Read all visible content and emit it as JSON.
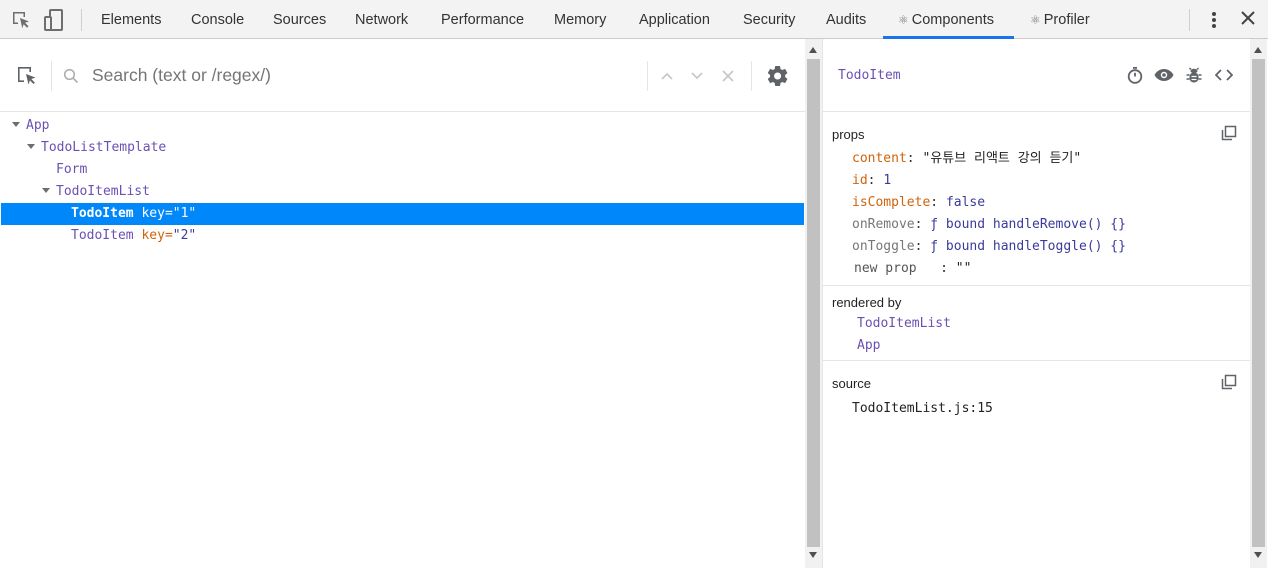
{
  "tabs": [
    {
      "label": "Elements"
    },
    {
      "label": "Console"
    },
    {
      "label": "Sources"
    },
    {
      "label": "Network"
    },
    {
      "label": "Performance"
    },
    {
      "label": "Memory"
    },
    {
      "label": "Application"
    },
    {
      "label": "Security"
    },
    {
      "label": "Audits"
    },
    {
      "label": "Components",
      "icon": "react-atom-icon",
      "active": true
    },
    {
      "label": "Profiler",
      "icon": "react-atom-icon"
    }
  ],
  "search": {
    "placeholder": "Search (text or /regex/)",
    "value": ""
  },
  "tree": [
    {
      "name": "App",
      "depth": 0,
      "expanded": true
    },
    {
      "name": "TodoListTemplate",
      "depth": 1,
      "expanded": true
    },
    {
      "name": "Form",
      "depth": 2
    },
    {
      "name": "TodoItemList",
      "depth": 2,
      "expanded": true
    },
    {
      "name": "TodoItem",
      "depth": 3,
      "key_label": "key",
      "key_value": "\"1\"",
      "selected": true
    },
    {
      "name": "TodoItem",
      "depth": 3,
      "key_label": "key",
      "key_value": "\"2\""
    }
  ],
  "inspector": {
    "title": "TodoItem",
    "props_title": "props",
    "props": [
      {
        "key": "content",
        "value": "\"유튜브 리액트 강의 듣기\"",
        "kind": "string"
      },
      {
        "key": "id",
        "value": "1",
        "kind": "number"
      },
      {
        "key": "isComplete",
        "value": "false",
        "kind": "bool"
      },
      {
        "key": "onRemove",
        "value": "ƒ bound handleRemove() {}",
        "kind": "function"
      },
      {
        "key": "onToggle",
        "value": "ƒ bound handleToggle() {}",
        "kind": "function"
      }
    ],
    "new_prop": {
      "key": "new prop",
      "value": "\"\""
    },
    "rendered_by_title": "rendered by",
    "rendered_by": [
      "TodoItemList",
      "App"
    ],
    "source_title": "source",
    "source": "TodoItemList.js:15"
  },
  "colors": {
    "accent": "#1a73e8",
    "selection": "#0088fa",
    "component": "#6a51b2",
    "prop_key": "#d0630c"
  }
}
